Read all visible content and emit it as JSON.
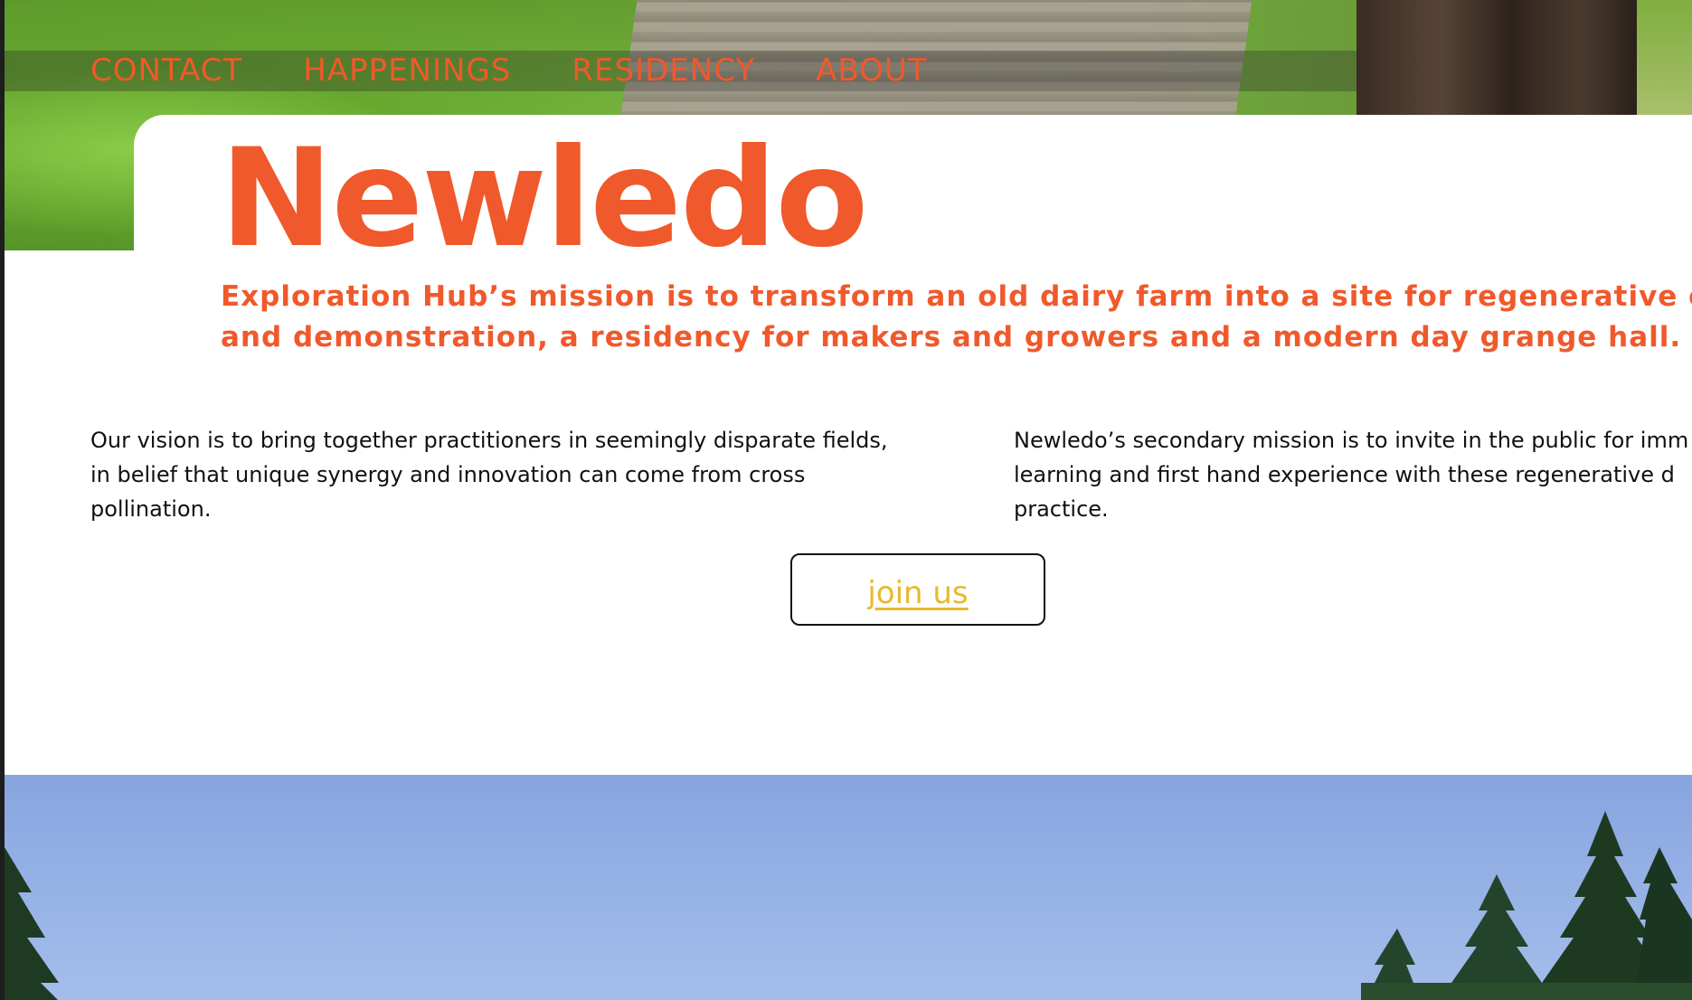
{
  "nav": {
    "items": [
      {
        "label": "CONTACT"
      },
      {
        "label": "HAPPENINGS"
      },
      {
        "label": "RESIDENCY"
      },
      {
        "label": "ABOUT"
      }
    ]
  },
  "hero": {
    "title": "Newledo",
    "mission_line1": "Exploration Hub’s mission is to transform an old dairy farm into a site for regenerative experi",
    "mission_line2": "and demonstration, a residency for makers and growers and a modern day grange hall."
  },
  "columns": {
    "left": {
      "line1": "Our vision is to bring together practitioners in seemingly disparate fields,",
      "line2": "in belief that unique synergy and innovation can come from cross",
      "line3": "pollination."
    },
    "right": {
      "line1": "Newledo’s secondary mission is to invite in the public for imm",
      "line2": "learning and first hand experience with these regenerative d",
      "line3": "practice."
    }
  },
  "cta": {
    "label": "join us"
  },
  "colors": {
    "accent": "#f0592b",
    "button_text": "#e8b82e",
    "body_text": "#111111",
    "sky": "#87a4e0"
  },
  "icons": {
    "hero_image": "boardwalk-photo",
    "bottom_image": "sky-trees-photo"
  }
}
